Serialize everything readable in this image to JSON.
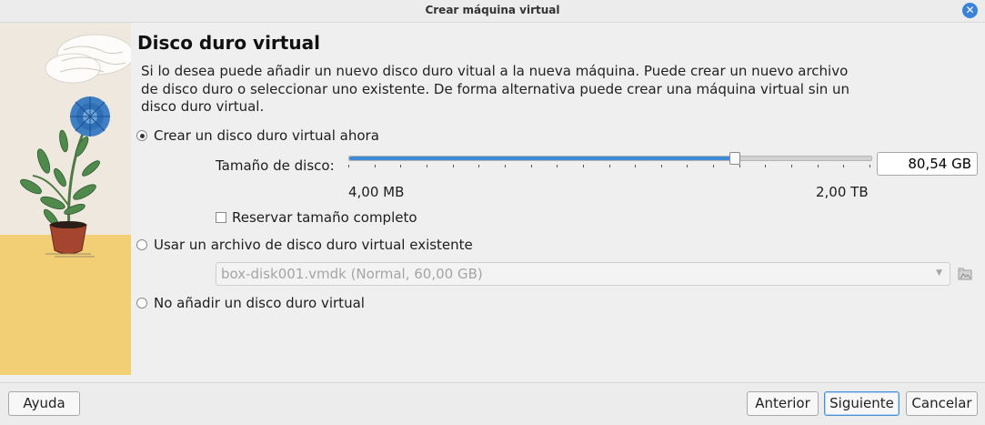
{
  "window": {
    "title": "Crear máquina virtual",
    "close_glyph": "✕"
  },
  "page": {
    "heading": "Disco duro virtual",
    "description": "Si lo desea puede añadir un nuevo disco duro vitual a la nueva máquina. Puede crear un nuevo archivo de disco duro o seleccionar uno existente. De forma alternativa puede crear una máquina virtual sin un disco duro virtual."
  },
  "options": {
    "create_new": {
      "label": "Crear un disco duro virtual ahora",
      "selected": true
    },
    "disk_size": {
      "label": "Tamaño de disco:",
      "value": "80,54 GB",
      "min_label": "4,00 MB",
      "max_label": "2,00 TB",
      "slider_fraction": 0.74
    },
    "reserve_full": {
      "label": "Reservar tamaño completo",
      "checked": false
    },
    "use_existing": {
      "label": "Usar un archivo de disco duro virtual existente",
      "selected": false
    },
    "existing_file": {
      "value": "box-disk001.vmdk (Normal, 60,00 GB)",
      "enabled": false
    },
    "no_disk": {
      "label": "No añadir un disco duro virtual",
      "selected": false
    }
  },
  "footer": {
    "help_label": "Ayuda",
    "back_label": "Anterior",
    "next_label": "Siguiente",
    "cancel_label": "Cancelar"
  },
  "icons": {
    "close": "close-icon",
    "folder": "folder-open-icon",
    "dropdown": "chevron-down-icon"
  },
  "colors": {
    "accent": "#3d8ad6",
    "close_button": "#3b83d9",
    "illustration_floor": "#f2cf75",
    "illustration_wall": "#efe9e1"
  }
}
